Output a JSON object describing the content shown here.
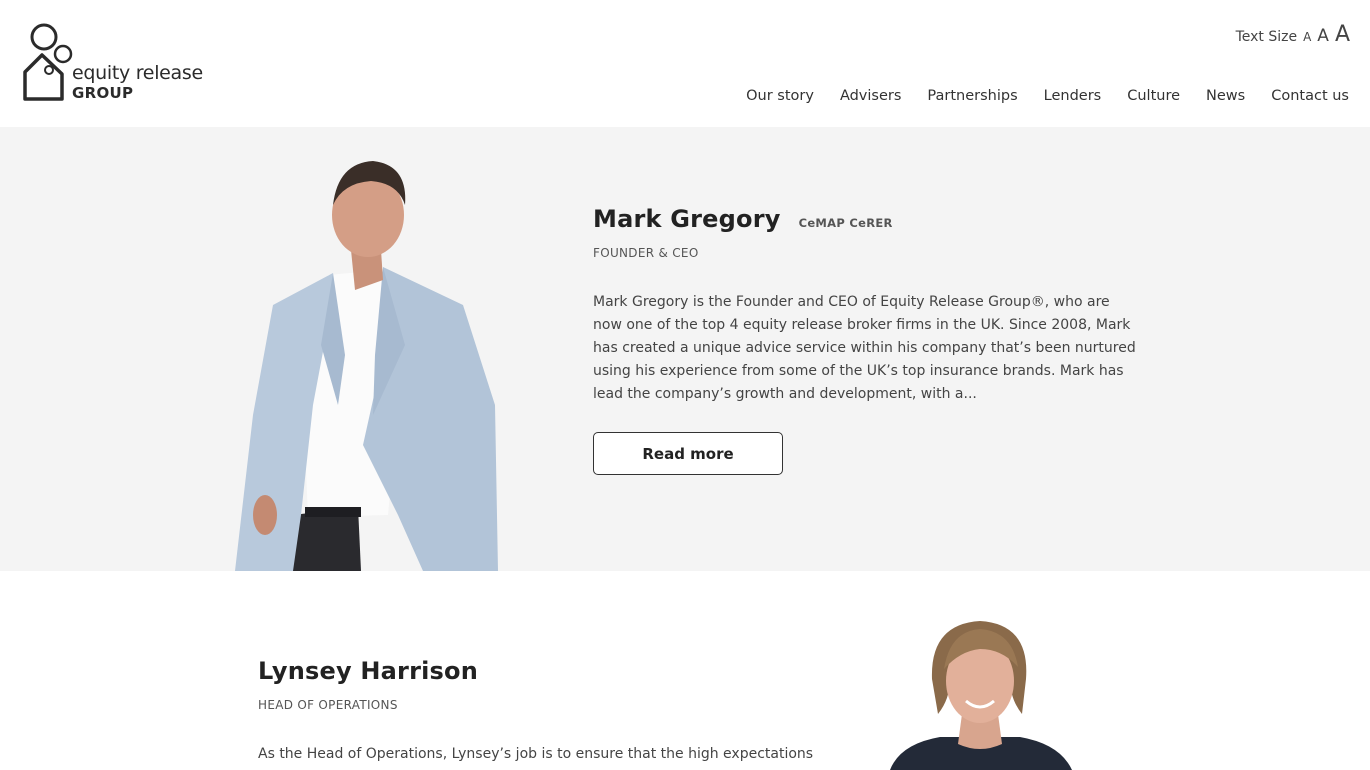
{
  "logo": {
    "line1": "equity release",
    "line2": "GROUP"
  },
  "text_size": {
    "label": "Text Size",
    "small": "A",
    "medium": "A",
    "large": "A"
  },
  "nav": {
    "items": [
      {
        "label": "Our story"
      },
      {
        "label": "Advisers"
      },
      {
        "label": "Partnerships"
      },
      {
        "label": "Lenders"
      },
      {
        "label": "Culture"
      },
      {
        "label": "News"
      },
      {
        "label": "Contact us"
      }
    ]
  },
  "person1": {
    "name": "Mark Gregory",
    "qualifications": "CeMAP CeRER",
    "role": "FOUNDER & CEO",
    "bio": "Mark Gregory is the Founder and CEO of Equity Release Group®, who are now one of the top 4 equity release broker firms in the UK. Since 2008, Mark has created a unique advice service within his company that’s been nurtured using his experience from some of the UK’s top insurance brands. Mark has lead the company’s growth and development, with a...",
    "read_more": "Read more"
  },
  "person2": {
    "name": "Lynsey Harrison",
    "role": "HEAD OF OPERATIONS",
    "bio": "As the Head of Operations, Lynsey’s job is to ensure that the high expectations"
  },
  "colors": {
    "section_bg": "#f4f4f4",
    "text": "#333333",
    "jacket": "#b8c9dc"
  }
}
